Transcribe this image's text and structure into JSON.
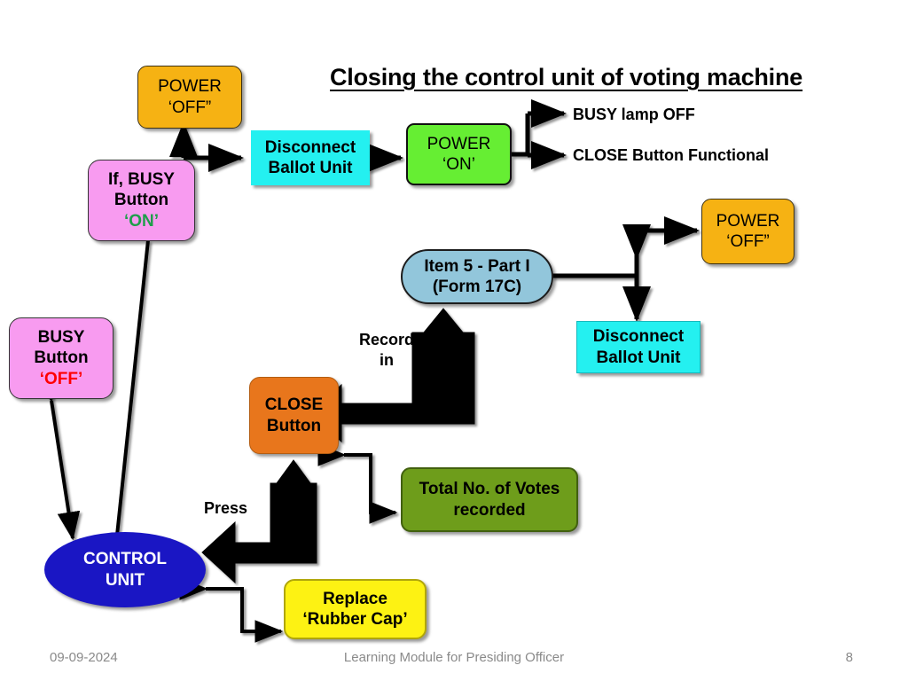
{
  "slide": {
    "title": "Closing the control unit of voting machine"
  },
  "nodes": {
    "power_off_top": {
      "line1": "POWER",
      "line2": "‘OFF”"
    },
    "if_busy_on": {
      "line1": "If, BUSY",
      "line2": "Button",
      "line3": "‘ON’"
    },
    "disconnect_top": {
      "line1": "Disconnect",
      "line2": "Ballot Unit"
    },
    "power_on": {
      "line1": "POWER",
      "line2": "‘ON’"
    },
    "busy_lamp_off": {
      "text": "BUSY lamp OFF"
    },
    "close_functional": {
      "text": "CLOSE Button Functional"
    },
    "power_off_right": {
      "line1": "POWER",
      "line2": "‘OFF”"
    },
    "item5": {
      "line1": "Item 5 - Part I",
      "line2": "(Form 17C)"
    },
    "disconnect_right": {
      "line1": "Disconnect",
      "line2": "Ballot Unit"
    },
    "busy_button_off": {
      "line1": "BUSY",
      "line2": "Button",
      "line3": "‘OFF’"
    },
    "close_button": {
      "line1": "CLOSE",
      "line2": "Button"
    },
    "total_votes": {
      "line1": "Total No. of Votes",
      "line2": "recorded"
    },
    "control_unit": {
      "line1": "CONTROL",
      "line2": "UNIT"
    },
    "replace_cap": {
      "line1": "Replace",
      "line2": "‘Rubber Cap’"
    }
  },
  "labels": {
    "record_in": {
      "line1": "Record",
      "line2": "in"
    },
    "press": {
      "text": "Press"
    }
  },
  "footer": {
    "date": "09-09-2024",
    "center": "Learning Module for Presiding Officer",
    "page": "8"
  },
  "colors": {
    "orange_power": "#F6B213",
    "pink": "#F89BF0",
    "cyan": "#24F0F0",
    "green_power_on": "#66EE33",
    "pill_blue": "#92C6DB",
    "close_orange": "#E8761C",
    "olive": "#6E9D1B",
    "yellow": "#FDF213",
    "control_blue": "#1A16C4",
    "state_on_green": "#1E9E4A",
    "state_off_red": "#FF0000",
    "footer_gray": "#8A8A8A"
  }
}
